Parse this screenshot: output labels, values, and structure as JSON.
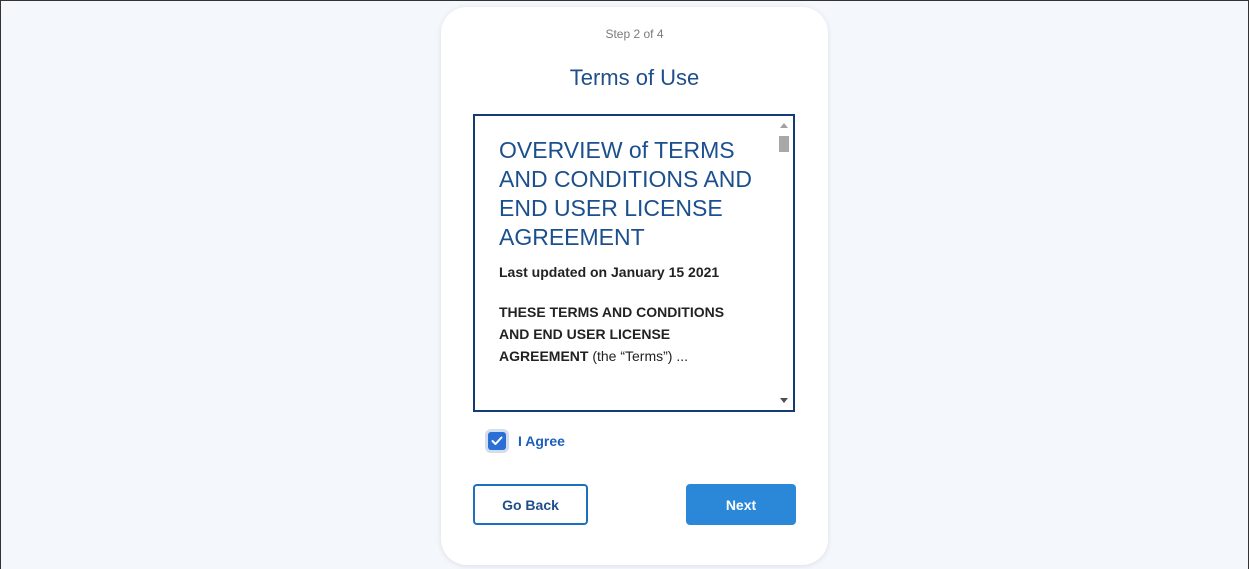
{
  "wizard": {
    "step_text": "Step 2 of 4",
    "title": "Terms of Use"
  },
  "terms": {
    "heading": "OVERVIEW of TERMS AND CONDITIONS AND END USER LICENSE AGREEMENT",
    "last_updated": "Last updated on January 15 2021",
    "body_bold": "THESE TERMS AND CONDITIONS AND END USER LICENSE AGREEMENT",
    "body_rest": " (the “Terms”) ..."
  },
  "agreement": {
    "label": "I Agree",
    "checked": true
  },
  "buttons": {
    "back_label": "Go Back",
    "next_label": "Next"
  },
  "colors": {
    "accent": "#2b88d8",
    "title": "#1f4f8a",
    "checkbox": "#2a6fd6",
    "page_bg": "#f4f8fd"
  },
  "icons": {
    "checkbox": "check-icon",
    "scroll_up": "arrow-up-icon",
    "scroll_down": "arrow-down-icon"
  }
}
